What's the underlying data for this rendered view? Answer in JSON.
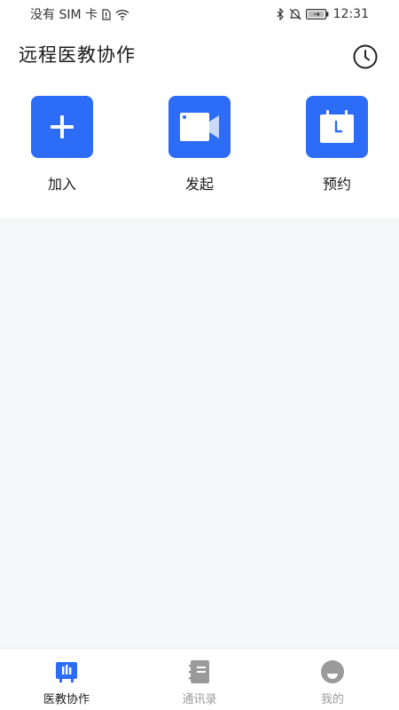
{
  "status_bar": {
    "carrier": "没有 SIM 卡",
    "time": "12:31",
    "icons": [
      "sim-icon",
      "wifi-icon",
      "bluetooth-icon",
      "mute-icon",
      "battery-icon"
    ]
  },
  "header": {
    "title": "远程医教协作",
    "history_icon": "clock-icon"
  },
  "actions": [
    {
      "label": "加入",
      "icon": "plus-icon"
    },
    {
      "label": "发起",
      "icon": "video-camera-icon"
    },
    {
      "label": "预约",
      "icon": "calendar-clock-icon"
    }
  ],
  "tabs": [
    {
      "label": "医教协作",
      "icon": "collaboration-icon",
      "active": true
    },
    {
      "label": "通讯录",
      "icon": "contacts-book-icon",
      "active": false
    },
    {
      "label": "我的",
      "icon": "profile-icon",
      "active": false
    }
  ],
  "colors": {
    "accent": "#2d6cf6",
    "inactive": "#9a9a9a",
    "background": "#f5f6f8"
  }
}
